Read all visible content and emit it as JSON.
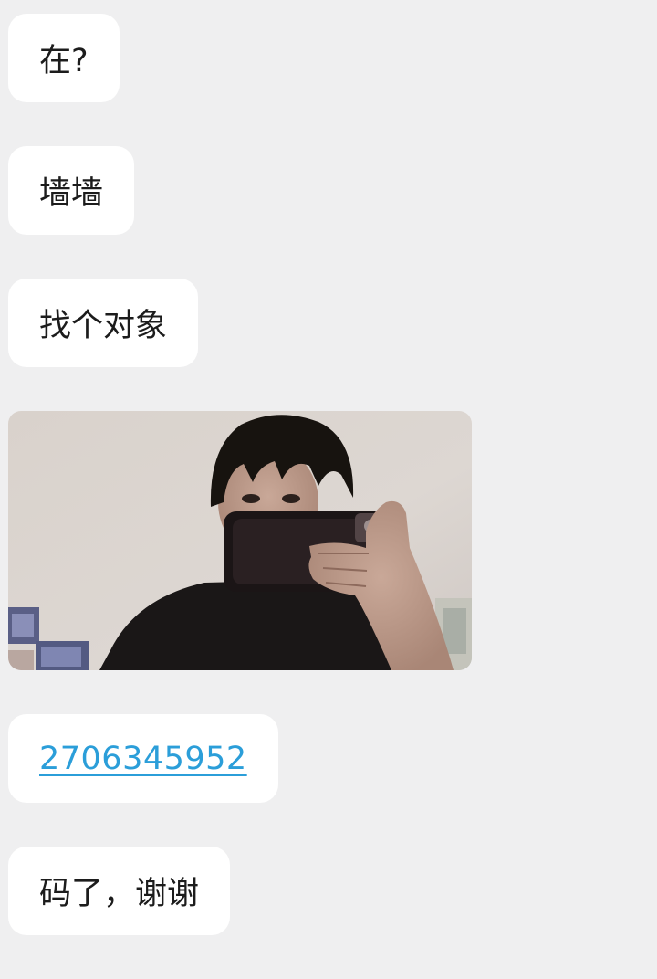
{
  "messages": [
    {
      "type": "text",
      "text": "在?"
    },
    {
      "type": "text",
      "text": "墙墙"
    },
    {
      "type": "text",
      "text": "找个对象"
    },
    {
      "type": "image",
      "description_icon": "photo-message"
    },
    {
      "type": "link",
      "text": "2706345952"
    },
    {
      "type": "text",
      "text": "码了，谢谢"
    }
  ],
  "colors": {
    "background": "#efeff0",
    "bubble": "#ffffff",
    "link": "#2b9ed9"
  }
}
